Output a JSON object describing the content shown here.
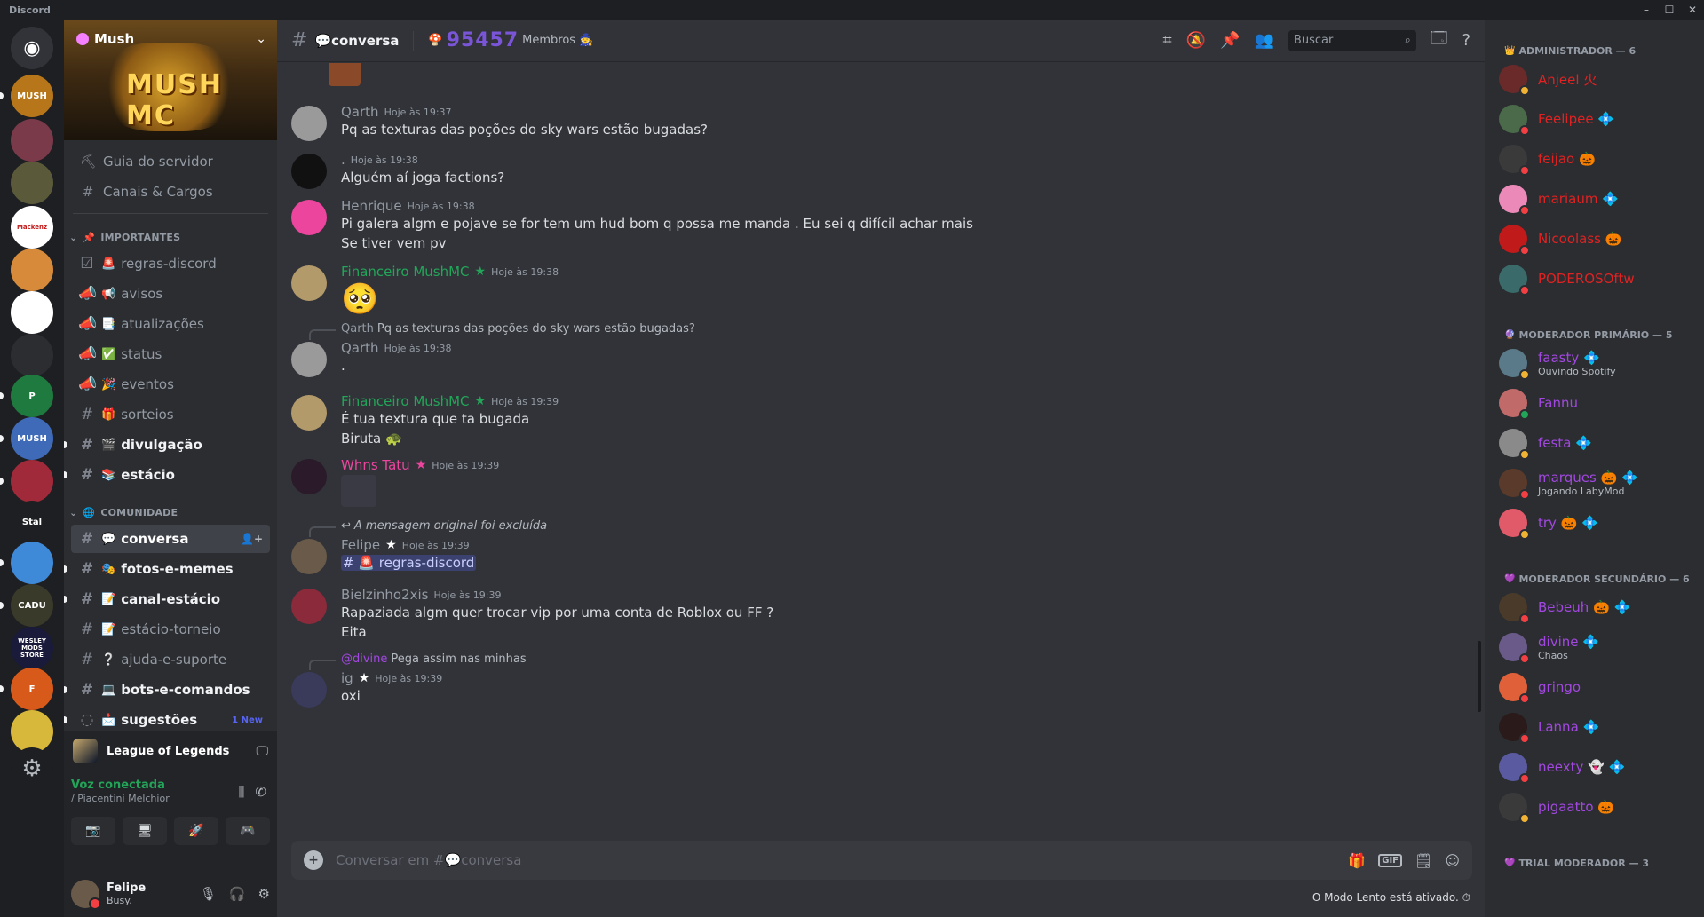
{
  "app": {
    "title": "Discord",
    "window_buttons": [
      "–",
      "☐",
      "✕"
    ]
  },
  "servers": [
    {
      "label": "",
      "icon": "discord-home-icon",
      "color": "#313338"
    },
    {
      "label": "MUSH",
      "icon": "server-mush-icon",
      "color": "#b8761a"
    },
    {
      "label": "",
      "icon": "server-avatar-icon",
      "color": "#7a3a4a"
    },
    {
      "label": "",
      "icon": "server-soldier-icon",
      "color": "#5a5a3a"
    },
    {
      "label": "Mackenz",
      "icon": "server-mackenzie-icon",
      "color": "#ffffff"
    },
    {
      "label": "",
      "icon": "server-pizza-icon",
      "color": "#d68a3a"
    },
    {
      "label": "",
      "icon": "server-chip-icon",
      "color": "#ffffff"
    },
    {
      "label": "",
      "icon": "server-triangle-icon",
      "color": "#2b2d31"
    },
    {
      "label": "P",
      "icon": "server-p-icon",
      "color": "#1e7a3e"
    },
    {
      "label": "MUSH",
      "icon": "server-mush2-icon",
      "color": "#3e6ab8"
    },
    {
      "label": "",
      "icon": "server-girl-icon",
      "color": "#a02a3a"
    },
    {
      "label": "Stal",
      "icon": "server-stal-icon",
      "color": "#1e1f22"
    },
    {
      "label": "",
      "icon": "server-bot-icon",
      "color": "#3e8ad8"
    },
    {
      "label": "CADU",
      "icon": "server-cadu-icon",
      "color": "#3a3a2a"
    },
    {
      "label": "WESLEY MODS STORE",
      "icon": "server-wesley-icon",
      "color": "#1a1a3a"
    },
    {
      "label": "F",
      "icon": "server-f-icon",
      "color": "#d85a1a"
    },
    {
      "label": "",
      "icon": "server-gold-icon",
      "color": "#d8b83a"
    },
    {
      "label": "",
      "icon": "discover-icon",
      "color": "#1e1f22"
    }
  ],
  "sidebar": {
    "server_name": "Mush",
    "banner_text": "MUSH MC",
    "nav": [
      {
        "label": "Guia do servidor",
        "icon": "guide-icon"
      },
      {
        "label": "Canais & Cargos",
        "icon": "channels-roles-icon"
      }
    ],
    "categories": [
      {
        "name": "IMPORTANTES",
        "icon": "📌",
        "channels": [
          {
            "name": "regras-discord",
            "emoji": "🚨",
            "type": "rules",
            "state": "normal"
          },
          {
            "name": "avisos",
            "emoji": "📢",
            "type": "announce",
            "state": "normal"
          },
          {
            "name": "atualizações",
            "emoji": "📑",
            "type": "announce",
            "state": "normal"
          },
          {
            "name": "status",
            "emoji": "✅",
            "type": "announce",
            "state": "normal"
          },
          {
            "name": "eventos",
            "emoji": "🎉",
            "type": "announce",
            "state": "normal"
          },
          {
            "name": "sorteios",
            "emoji": "🎁",
            "type": "text",
            "state": "normal"
          },
          {
            "name": "divulgação",
            "emoji": "🎬",
            "type": "text",
            "state": "unread"
          },
          {
            "name": "estácio",
            "emoji": "📚",
            "type": "text",
            "state": "unread"
          }
        ]
      },
      {
        "name": "COMUNIDADE",
        "icon": "🌐",
        "channels": [
          {
            "name": "conversa",
            "emoji": "💬",
            "type": "text",
            "state": "active"
          },
          {
            "name": "fotos-e-memes",
            "emoji": "🎭",
            "type": "text",
            "state": "unread"
          },
          {
            "name": "canal-estácio",
            "emoji": "📝",
            "type": "text",
            "state": "unread"
          },
          {
            "name": "estácio-torneio",
            "emoji": "📝",
            "type": "text",
            "state": "normal"
          },
          {
            "name": "ajuda-e-suporte",
            "emoji": "❔",
            "type": "text",
            "state": "normal"
          },
          {
            "name": "bots-e-comandos",
            "emoji": "💻",
            "type": "text",
            "state": "unread"
          },
          {
            "name": "sugestões",
            "emoji": "📩",
            "type": "forum",
            "state": "unread",
            "badge": "1 New"
          }
        ]
      }
    ],
    "activity": {
      "game": "League of Legends"
    },
    "voice": {
      "status": "Voz conectada",
      "channel": "/ Piacentini Melchior",
      "buttons": [
        "📷",
        "🖥",
        "🚀",
        "🎮"
      ]
    },
    "user": {
      "name": "Felipe",
      "status": "Busy."
    }
  },
  "header": {
    "hash": "#",
    "channel": "💬conversa",
    "topic_icon": "🍄",
    "member_count": "95457",
    "topic_label": "Membros",
    "topic_end": "🧙",
    "search_placeholder": "Buscar"
  },
  "messages": [
    {
      "author": "Qarth",
      "time": "Hoje às 19:37",
      "text": [
        "Pq as texturas das poções do sky wars estão bugadas?"
      ],
      "color": "#949ba4",
      "avatar": "#9a9a9a"
    },
    {
      "author": ".",
      "time": "Hoje às 19:38",
      "text": [
        "Alguém aí joga factions?"
      ],
      "color": "#949ba4",
      "avatar": "#111111"
    },
    {
      "author": "Henrique",
      "time": "Hoje às 19:38",
      "text": [
        "Pi galera algm e pojave se for tem um hud bom q  possa me manda . Eu sei q difícil achar mais",
        "Se  tiver vem pv"
      ],
      "color": "#949ba4",
      "avatar": "#eb459e"
    },
    {
      "author": "Financeiro MushMC",
      "time": "Hoje às 19:38",
      "text": [
        "🥺"
      ],
      "color": "#23a559",
      "avatar": "#b39a6a"
    },
    {
      "author": "Qarth",
      "time": "Hoje às 19:38",
      "text": [
        "."
      ],
      "color": "#949ba4",
      "avatar": "#9a9a9a",
      "reply": {
        "author": "Qarth",
        "text": "Pq as texturas das poções do sky wars estão bugadas?"
      }
    },
    {
      "author": "Financeiro MushMC",
      "time": "Hoje às 19:39",
      "text": [
        "É tua textura que ta bugada",
        "Biruta 🐢"
      ],
      "color": "#23a559",
      "avatar": "#b39a6a"
    },
    {
      "author": "Whns Tatu",
      "time": "Hoje às 19:39",
      "text": [
        ""
      ],
      "color": "#eb459e",
      "avatar": "#2a1a2a"
    },
    {
      "author": "Felipe",
      "time": "Hoje às 19:39",
      "text": [
        "# 🚨 regras-discord"
      ],
      "color": "#949ba4",
      "avatar": "#6a5a4a",
      "reply": {
        "author": "",
        "text": "A mensagem original foi excluída"
      }
    },
    {
      "author": "Bielzinho2xis",
      "time": "Hoje às 19:39",
      "text": [
        "Rapaziada algm quer trocar vip por uma conta de  Roblox ou FF ?",
        "Eita"
      ],
      "color": "#949ba4",
      "avatar": "#8a2a3a"
    },
    {
      "author": "ig",
      "time": "Hoje às 19:39",
      "text": [
        "oxi"
      ],
      "color": "#949ba4",
      "avatar": "#3a3a5a",
      "reply": {
        "author": "@divine",
        "text": "Pega assim nas minhas"
      }
    }
  ],
  "composer": {
    "placeholder": "Conversar em #💬conversa",
    "slowmode": "O Modo Lento está ativado."
  },
  "members": {
    "roles": [
      {
        "name": "ADMINISTRADOR — 6",
        "color": "#e02222",
        "icon": "👑",
        "members": [
          {
            "name": "Anjeel 火",
            "status": "#f0b232",
            "avatar": "#6a2a2a"
          },
          {
            "name": "Feelipee 💠",
            "status": "#f23f43",
            "avatar": "#4a6a4a"
          },
          {
            "name": "feijao 🎃",
            "status": "#f23f43",
            "avatar": "#3a3a3a"
          },
          {
            "name": "mariaum 💠",
            "status": "#f23f43",
            "avatar": "#eb8ab8"
          },
          {
            "name": "Nicoolass 🎃",
            "status": "#f23f43",
            "avatar": "#c01a1a"
          },
          {
            "name": "PODEROSOftw",
            "status": "#f23f43",
            "avatar": "#3a6a6a"
          }
        ]
      },
      {
        "name": "MODERADOR PRIMÁRIO — 5",
        "color": "#a248e0",
        "icon": "🔮",
        "members": [
          {
            "name": "faasty 💠",
            "sub": "Ouvindo Spotify",
            "status": "#f0b232",
            "avatar": "#5a7a8a"
          },
          {
            "name": "Fannu",
            "status": "#23a559",
            "avatar": "#c06a6a"
          },
          {
            "name": "festa 💠",
            "status": "#f0b232",
            "avatar": "#8a8a8a"
          },
          {
            "name": "marques 🎃 💠",
            "sub": "Jogando LabyMod",
            "status": "#f23f43",
            "avatar": "#5a3a2a"
          },
          {
            "name": "try 🎃 💠",
            "status": "#f0b232",
            "avatar": "#e05a6a"
          }
        ]
      },
      {
        "name": "MODERADOR SECUNDÁRIO — 6",
        "color": "#a248e0",
        "icon": "💜",
        "members": [
          {
            "name": "Bebeuh 🎃 💠",
            "status": "#f23f43",
            "avatar": "#4a3a2a"
          },
          {
            "name": "divine 💠",
            "sub": "Chaos",
            "status": "#f23f43",
            "avatar": "#6a5a8a"
          },
          {
            "name": "gringo",
            "status": "#f23f43",
            "avatar": "#e0603a"
          },
          {
            "name": "Lanna 💠",
            "status": "#f23f43",
            "avatar": "#2a1a1a"
          },
          {
            "name": "neexty 👻 💠",
            "status": "#f23f43",
            "avatar": "#5a5aa0"
          },
          {
            "name": "pigaatto 🎃",
            "status": "#f0b232",
            "avatar": "#3a3a3a"
          }
        ]
      },
      {
        "name": "TRIAL MODERADOR — 3",
        "color": "#a248e0",
        "icon": "💜",
        "members": []
      }
    ]
  }
}
